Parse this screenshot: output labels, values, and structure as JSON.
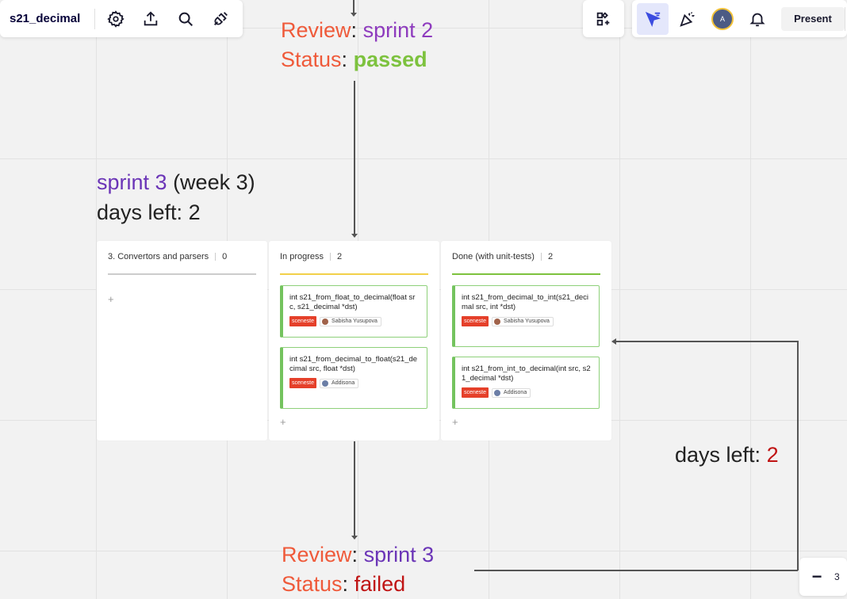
{
  "board": {
    "title": "s21_decimal"
  },
  "toolbar_left": {
    "icons": [
      "settings-icon",
      "share-icon",
      "search-icon",
      "plugin-icon"
    ]
  },
  "toolbar_right": {
    "avatar_initial": "A",
    "present_label": "Present"
  },
  "top_review": {
    "review_label": "Review",
    "colon": ":",
    "sprint_value": "sprint 2",
    "status_label": "Status",
    "status_value": "passed"
  },
  "sprint_heading": {
    "sprint": "sprint 3",
    "week": "(week 3)",
    "days_left_label": "days left:",
    "days_left_value": "2"
  },
  "columns": [
    {
      "title": "3. Convertors and parsers",
      "count": "0",
      "line_color": "#cccccc",
      "add": "+"
    },
    {
      "title": "In progress",
      "count": "2",
      "line_color": "#f2d04a",
      "add": "+",
      "cards": [
        {
          "title": "int s21_from_float_to_decimal(float src, s21_decimal *dst)",
          "tag": "sceneste",
          "person": "Sabisha Yusupova"
        },
        {
          "title": "int s21_from_decimal_to_float(s21_decimal src, float *dst)",
          "tag": "sceneste",
          "person": "Addisona"
        }
      ]
    },
    {
      "title": "Done (with unit-tests)",
      "count": "2",
      "line_color": "#7dc23e",
      "add": "+",
      "cards": [
        {
          "title": "int s21_from_decimal_to_int(s21_decimal src, int *dst)",
          "tag": "sceneste",
          "person": "Sabisha Yusupova"
        },
        {
          "title": "int s21_from_int_to_decimal(int src, s21_decimal *dst)",
          "tag": "sceneste",
          "person": "Addisona"
        }
      ]
    }
  ],
  "side_days_left": {
    "label": "days left:",
    "value": "2"
  },
  "bottom_review": {
    "review_label": "Review",
    "colon": ":",
    "sprint_value": "sprint 3",
    "status_label": "Status",
    "status_value": "failed"
  },
  "zoom": {
    "minus": "−",
    "value": "3"
  },
  "colors": {
    "orange": "#ef5a3a",
    "purple": "#8e3bbe",
    "green": "#7dc23e",
    "red": "#c01414",
    "tag_red": "#e5402a"
  }
}
